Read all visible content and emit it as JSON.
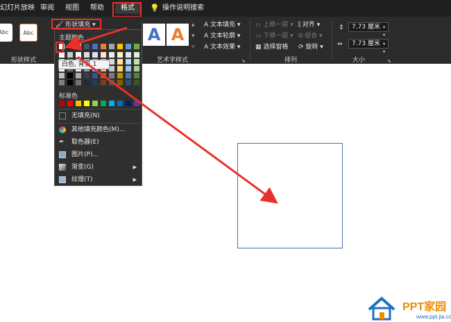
{
  "tabs": [
    "幻灯片放映",
    "审阅",
    "视图",
    "帮助",
    "格式"
  ],
  "tell_me": "操作说明搜索",
  "ribbon": {
    "shape_styles_label": "形状样式",
    "wordart_label": "艺术字样式",
    "arrange_label": "排列",
    "size_label": "大小",
    "shape_fill": "形状填充",
    "abc": "Abc",
    "bigA": "A",
    "text_fill": "文本填充",
    "text_outline": "文本轮廓",
    "text_effect": "文本效果",
    "bring_forward": "上移一层",
    "send_backward": "下移一层",
    "selection_pane": "选择窗格",
    "align": "对齐",
    "group": "组合",
    "rotate": "旋转",
    "height": "7.73 厘米",
    "width": "7.73 厘米"
  },
  "menu": {
    "theme_colors": "主题颜色",
    "standard_colors": "标准色",
    "tooltip": "白色, 背景 1",
    "items": [
      "无填充(N)",
      "其他填充颜色(M)...",
      "取色器(E)",
      "图片(P)...",
      "渐变(G)",
      "纹理(T)"
    ],
    "theme_top": [
      "#ffffff",
      "#000000",
      "#e7e6e6",
      "#44546a",
      "#4472c4",
      "#ed7d31",
      "#a5a5a5",
      "#ffc000",
      "#5b9bd5",
      "#70ad47"
    ],
    "standard": [
      "#c00000",
      "#ff0000",
      "#ffc000",
      "#ffff00",
      "#92d050",
      "#00b050",
      "#00b0f0",
      "#0070c0",
      "#002060",
      "#7030a0"
    ]
  },
  "logo": {
    "brand": "PPT家园",
    "url": "www.ppt.jia.com"
  },
  "colors": {
    "arrow": "#e8312a",
    "accent_logo": "#f08c00",
    "shape_border": "#4a6bb0"
  }
}
